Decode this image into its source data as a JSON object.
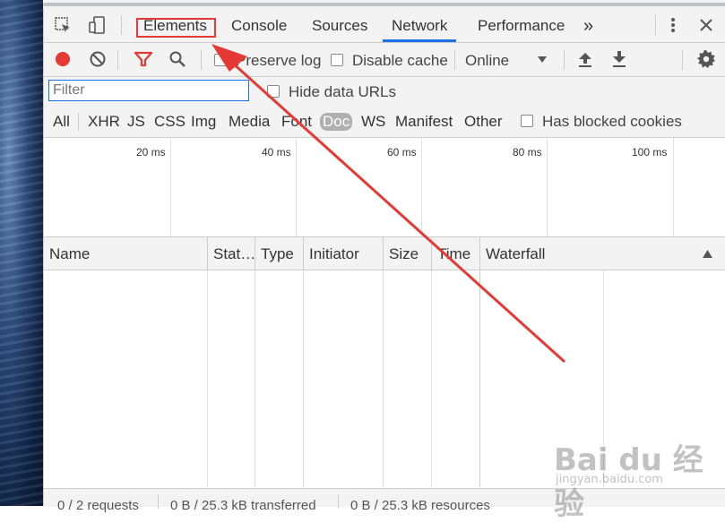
{
  "tabs": {
    "items": [
      "Elements",
      "Console",
      "Sources",
      "Network",
      "Performance"
    ],
    "active": "Network",
    "more": "»"
  },
  "toolbar": {
    "preserve_log": "Preserve log",
    "disable_cache": "Disable cache",
    "throttle": "Online"
  },
  "filter": {
    "placeholder": "Filter",
    "hide_data_urls": "Hide data URLs",
    "types": [
      "All",
      "XHR",
      "JS",
      "CSS",
      "Img",
      "Media",
      "Font",
      "Doc",
      "WS",
      "Manifest",
      "Other"
    ],
    "selected_type": "Doc",
    "has_blocked_cookies": "Has blocked cookies"
  },
  "overview": {
    "ticks": [
      "20 ms",
      "40 ms",
      "60 ms",
      "80 ms",
      "100 ms"
    ]
  },
  "table": {
    "columns": [
      "Name",
      "Stat…",
      "Type",
      "Initiator",
      "Size",
      "Time",
      "Waterfall"
    ]
  },
  "status": {
    "requests": "0 / 2 requests",
    "transferred": "0 B / 25.3 kB transferred",
    "resources": "0 B / 25.3 kB resources"
  },
  "watermark": {
    "main": "Bai du 经验",
    "url": "jingyan.baidu.com"
  },
  "colors": {
    "active_tab_underline": "#1a73e8",
    "record": "#e53935",
    "annotation": "#e53935"
  }
}
